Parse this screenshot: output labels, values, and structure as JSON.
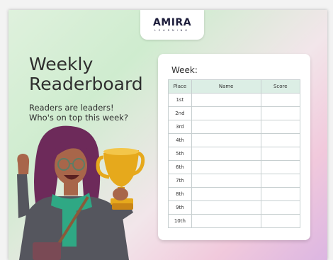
{
  "brand": {
    "name": "AMIRA",
    "tagline": "LEARNING"
  },
  "heading": {
    "line1": "Weekly",
    "line2": "Readerboard"
  },
  "subheading": {
    "line1": "Readers are leaders!",
    "line2": "Who's on top this week?"
  },
  "board": {
    "week_label": "Week:",
    "columns": [
      "Place",
      "Name",
      "Score"
    ],
    "rows": [
      {
        "place": "1st",
        "name": "",
        "score": ""
      },
      {
        "place": "2nd",
        "name": "",
        "score": ""
      },
      {
        "place": "3rd",
        "name": "",
        "score": ""
      },
      {
        "place": "4th",
        "name": "",
        "score": ""
      },
      {
        "place": "5th",
        "name": "",
        "score": ""
      },
      {
        "place": "6th",
        "name": "",
        "score": ""
      },
      {
        "place": "7th",
        "name": "",
        "score": ""
      },
      {
        "place": "8th",
        "name": "",
        "score": ""
      },
      {
        "place": "9th",
        "name": "",
        "score": ""
      },
      {
        "place": "10th",
        "name": "",
        "score": ""
      }
    ]
  },
  "colors": {
    "header_fill": "#dceee5",
    "trophy": "#e6a91c",
    "hair": "#6d2a5a",
    "jacket": "#55565e",
    "scarf": "#2fa884"
  },
  "illustration": {
    "subject": "girl-with-trophy",
    "icon": "trophy-icon"
  }
}
